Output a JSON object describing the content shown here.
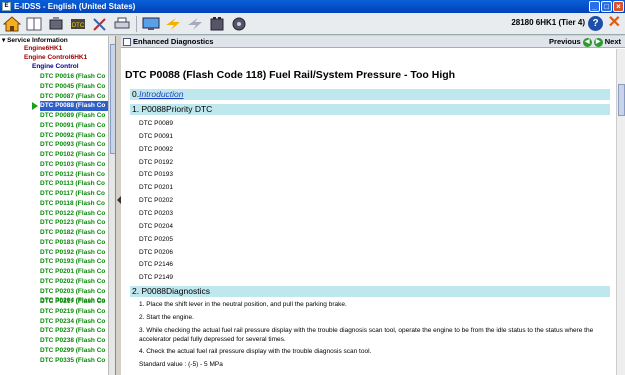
{
  "window": {
    "title": "E-IDSS - English (United States)"
  },
  "toolbar": {
    "icons": [
      "home-icon",
      "book-icon",
      "engine-icon",
      "diagnostics-icon",
      "tools-icon",
      "printer-icon",
      "monitor-icon",
      "flash-icon",
      "lightning-icon",
      "battery-icon",
      "engine-gear-icon"
    ],
    "vehicle_info": "28180 6HK1 (Tier 4)",
    "help_label": "?"
  },
  "tree": {
    "root": "Service Information",
    "level1": "Engine6HK1",
    "level2": "Engine Control6HK1",
    "level3": "Engine Control",
    "items_top": [
      "DTC P0016 (Flash Co",
      "DTC P0045 (Flash Co",
      "DTC P0087 (Flash Co",
      "DTC P0088 (Flash Co",
      "DTC P0089 (Flash Co",
      "DTC P0091 (Flash Co",
      "DTC P0092 (Flash Co",
      "DTC P0093 (Flash Co",
      "DTC P0102 (Flash Co",
      "DTC P0103 (Flash Co",
      "DTC P0112 (Flash Co",
      "DTC P0113 (Flash Co",
      "DTC P0117 (Flash Co",
      "DTC P0118 (Flash Co",
      "DTC P0122 (Flash Co",
      "DTC P0123 (Flash Co",
      "DTC P0182 (Flash Co",
      "DTC P0183 (Flash Co",
      "DTC P0192 (Flash Co",
      "DTC P0193 (Flash Co",
      "DTC P0201 (Flash Co",
      "DTC P0202 (Flash Co",
      "DTC P0203 (Flash Co",
      "DTC P0204 (Flash Co"
    ],
    "items_bottom": [
      "DTC P0217 (Flash Co",
      "DTC P0219 (Flash Co",
      "DTC P0234 (Flash Co",
      "DTC P0237 (Flash Co",
      "DTC P0238 (Flash Co",
      "DTC P0299 (Flash Co",
      "DTC P0335 (Flash Co"
    ],
    "selected_index": 3
  },
  "content": {
    "header_title": "Enhanced Diagnostics",
    "nav_previous": "Previous",
    "nav_next": "Next",
    "doc_title": "DTC P0088 (Flash Code 118) Fuel Rail/System Pressure - Too High",
    "section0_num": "0.",
    "section0_link": "Introduction",
    "section1": "1. P0088Priority DTC",
    "dtc_list": [
      "DTC P0089",
      "DTC P0091",
      "DTC P0092",
      "DTC P0192",
      "DTC P0193",
      "DTC P0201",
      "DTC P0202",
      "DTC P0203",
      "DTC P0204",
      "DTC P0205",
      "DTC P0206",
      "DTC P2146",
      "DTC P2149"
    ],
    "section2": "2. P0088Diagnostics",
    "steps": [
      "1. Place the shift lever in the neutral position, and pull the parking brake.",
      "2. Start the engine.",
      "3. While checking the actual fuel rail pressure display with the trouble diagnosis scan tool, operate the engine to be from the idle status to the status where the accelerator pedal fully depressed for several times.",
      "4. Check the actual fuel rail pressure display with the trouble diagnosis scan tool.",
      "Standard value : (-5) - 5 MPa"
    ]
  },
  "colors": {
    "title_bar": "#0042b8",
    "selected": "#2d5fc8",
    "band": "#bfe7ee",
    "tree_green": "#0a8a0a",
    "tree_red": "#a00000"
  }
}
